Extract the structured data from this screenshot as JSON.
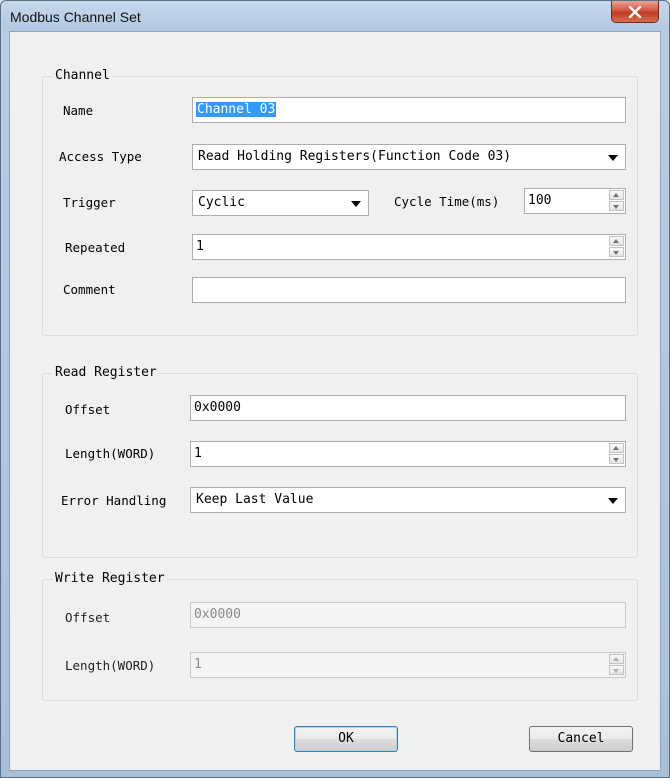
{
  "window": {
    "title": "Modbus Channel Set"
  },
  "channel": {
    "legend": "Channel",
    "name_label": "Name",
    "name_value": "Channel 03",
    "access_type_label": "Access Type",
    "access_type_value": "Read Holding Registers(Function Code 03)",
    "trigger_label": "Trigger",
    "trigger_value": "Cyclic",
    "cycle_time_label": "Cycle Time(ms)",
    "cycle_time_value": "100",
    "repeated_label": "Repeated",
    "repeated_value": "1",
    "comment_label": "Comment",
    "comment_value": ""
  },
  "read_register": {
    "legend": "Read Register",
    "offset_label": "Offset",
    "offset_value": "0x0000",
    "length_label": "Length(WORD)",
    "length_value": "1",
    "error_label": "Error Handling",
    "error_value": "Keep Last Value"
  },
  "write_register": {
    "legend": "Write Register",
    "offset_label": "Offset",
    "offset_value": "0x0000",
    "length_label": "Length(WORD)",
    "length_value": "1"
  },
  "buttons": {
    "ok": "OK",
    "cancel": "Cancel"
  },
  "icons": {
    "close": "close-icon",
    "dropdown": "chevron-down-icon",
    "spin": "spin-arrows-icon"
  }
}
